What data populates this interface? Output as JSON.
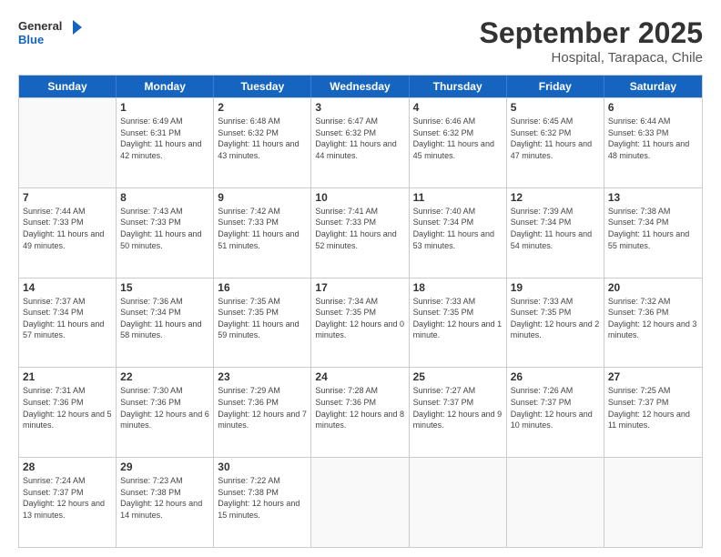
{
  "logo": {
    "line1": "General",
    "line2": "Blue"
  },
  "title": "September 2025",
  "subtitle": "Hospital, Tarapaca, Chile",
  "weekdays": [
    "Sunday",
    "Monday",
    "Tuesday",
    "Wednesday",
    "Thursday",
    "Friday",
    "Saturday"
  ],
  "weeks": [
    [
      {
        "day": "",
        "sunrise": "",
        "sunset": "",
        "daylight": ""
      },
      {
        "day": "1",
        "sunrise": "Sunrise: 6:49 AM",
        "sunset": "Sunset: 6:31 PM",
        "daylight": "Daylight: 11 hours and 42 minutes."
      },
      {
        "day": "2",
        "sunrise": "Sunrise: 6:48 AM",
        "sunset": "Sunset: 6:32 PM",
        "daylight": "Daylight: 11 hours and 43 minutes."
      },
      {
        "day": "3",
        "sunrise": "Sunrise: 6:47 AM",
        "sunset": "Sunset: 6:32 PM",
        "daylight": "Daylight: 11 hours and 44 minutes."
      },
      {
        "day": "4",
        "sunrise": "Sunrise: 6:46 AM",
        "sunset": "Sunset: 6:32 PM",
        "daylight": "Daylight: 11 hours and 45 minutes."
      },
      {
        "day": "5",
        "sunrise": "Sunrise: 6:45 AM",
        "sunset": "Sunset: 6:32 PM",
        "daylight": "Daylight: 11 hours and 47 minutes."
      },
      {
        "day": "6",
        "sunrise": "Sunrise: 6:44 AM",
        "sunset": "Sunset: 6:33 PM",
        "daylight": "Daylight: 11 hours and 48 minutes."
      }
    ],
    [
      {
        "day": "7",
        "sunrise": "Sunrise: 7:44 AM",
        "sunset": "Sunset: 7:33 PM",
        "daylight": "Daylight: 11 hours and 49 minutes."
      },
      {
        "day": "8",
        "sunrise": "Sunrise: 7:43 AM",
        "sunset": "Sunset: 7:33 PM",
        "daylight": "Daylight: 11 hours and 50 minutes."
      },
      {
        "day": "9",
        "sunrise": "Sunrise: 7:42 AM",
        "sunset": "Sunset: 7:33 PM",
        "daylight": "Daylight: 11 hours and 51 minutes."
      },
      {
        "day": "10",
        "sunrise": "Sunrise: 7:41 AM",
        "sunset": "Sunset: 7:33 PM",
        "daylight": "Daylight: 11 hours and 52 minutes."
      },
      {
        "day": "11",
        "sunrise": "Sunrise: 7:40 AM",
        "sunset": "Sunset: 7:34 PM",
        "daylight": "Daylight: 11 hours and 53 minutes."
      },
      {
        "day": "12",
        "sunrise": "Sunrise: 7:39 AM",
        "sunset": "Sunset: 7:34 PM",
        "daylight": "Daylight: 11 hours and 54 minutes."
      },
      {
        "day": "13",
        "sunrise": "Sunrise: 7:38 AM",
        "sunset": "Sunset: 7:34 PM",
        "daylight": "Daylight: 11 hours and 55 minutes."
      }
    ],
    [
      {
        "day": "14",
        "sunrise": "Sunrise: 7:37 AM",
        "sunset": "Sunset: 7:34 PM",
        "daylight": "Daylight: 11 hours and 57 minutes."
      },
      {
        "day": "15",
        "sunrise": "Sunrise: 7:36 AM",
        "sunset": "Sunset: 7:34 PM",
        "daylight": "Daylight: 11 hours and 58 minutes."
      },
      {
        "day": "16",
        "sunrise": "Sunrise: 7:35 AM",
        "sunset": "Sunset: 7:35 PM",
        "daylight": "Daylight: 11 hours and 59 minutes."
      },
      {
        "day": "17",
        "sunrise": "Sunrise: 7:34 AM",
        "sunset": "Sunset: 7:35 PM",
        "daylight": "Daylight: 12 hours and 0 minutes."
      },
      {
        "day": "18",
        "sunrise": "Sunrise: 7:33 AM",
        "sunset": "Sunset: 7:35 PM",
        "daylight": "Daylight: 12 hours and 1 minute."
      },
      {
        "day": "19",
        "sunrise": "Sunrise: 7:33 AM",
        "sunset": "Sunset: 7:35 PM",
        "daylight": "Daylight: 12 hours and 2 minutes."
      },
      {
        "day": "20",
        "sunrise": "Sunrise: 7:32 AM",
        "sunset": "Sunset: 7:36 PM",
        "daylight": "Daylight: 12 hours and 3 minutes."
      }
    ],
    [
      {
        "day": "21",
        "sunrise": "Sunrise: 7:31 AM",
        "sunset": "Sunset: 7:36 PM",
        "daylight": "Daylight: 12 hours and 5 minutes."
      },
      {
        "day": "22",
        "sunrise": "Sunrise: 7:30 AM",
        "sunset": "Sunset: 7:36 PM",
        "daylight": "Daylight: 12 hours and 6 minutes."
      },
      {
        "day": "23",
        "sunrise": "Sunrise: 7:29 AM",
        "sunset": "Sunset: 7:36 PM",
        "daylight": "Daylight: 12 hours and 7 minutes."
      },
      {
        "day": "24",
        "sunrise": "Sunrise: 7:28 AM",
        "sunset": "Sunset: 7:36 PM",
        "daylight": "Daylight: 12 hours and 8 minutes."
      },
      {
        "day": "25",
        "sunrise": "Sunrise: 7:27 AM",
        "sunset": "Sunset: 7:37 PM",
        "daylight": "Daylight: 12 hours and 9 minutes."
      },
      {
        "day": "26",
        "sunrise": "Sunrise: 7:26 AM",
        "sunset": "Sunset: 7:37 PM",
        "daylight": "Daylight: 12 hours and 10 minutes."
      },
      {
        "day": "27",
        "sunrise": "Sunrise: 7:25 AM",
        "sunset": "Sunset: 7:37 PM",
        "daylight": "Daylight: 12 hours and 11 minutes."
      }
    ],
    [
      {
        "day": "28",
        "sunrise": "Sunrise: 7:24 AM",
        "sunset": "Sunset: 7:37 PM",
        "daylight": "Daylight: 12 hours and 13 minutes."
      },
      {
        "day": "29",
        "sunrise": "Sunrise: 7:23 AM",
        "sunset": "Sunset: 7:38 PM",
        "daylight": "Daylight: 12 hours and 14 minutes."
      },
      {
        "day": "30",
        "sunrise": "Sunrise: 7:22 AM",
        "sunset": "Sunset: 7:38 PM",
        "daylight": "Daylight: 12 hours and 15 minutes."
      },
      {
        "day": "",
        "sunrise": "",
        "sunset": "",
        "daylight": ""
      },
      {
        "day": "",
        "sunrise": "",
        "sunset": "",
        "daylight": ""
      },
      {
        "day": "",
        "sunrise": "",
        "sunset": "",
        "daylight": ""
      },
      {
        "day": "",
        "sunrise": "",
        "sunset": "",
        "daylight": ""
      }
    ]
  ]
}
